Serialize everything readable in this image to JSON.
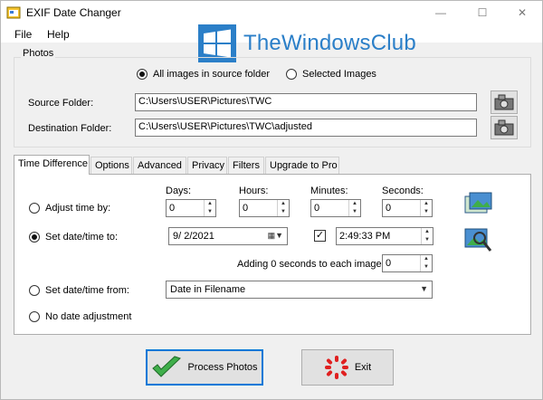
{
  "window": {
    "title": "EXIF Date Changer"
  },
  "watermark": {
    "text": "TheWindowsClub"
  },
  "menu": {
    "file": "File",
    "help": "Help"
  },
  "photos": {
    "group_label": "Photos",
    "radio_all": "All images in source folder",
    "radio_selected": "Selected Images",
    "source_label": "Source Folder:",
    "source_value": "C:\\Users\\USER\\Pictures\\TWC",
    "dest_label": "Destination Folder:",
    "dest_value": "C:\\Users\\USER\\Pictures\\TWC\\adjusted"
  },
  "tabs": [
    "Time Difference",
    "Options",
    "Advanced",
    "Privacy",
    "Filters",
    "Upgrade to Pro"
  ],
  "time": {
    "adjust_label": "Adjust time by:",
    "days_label": "Days:",
    "hours_label": "Hours:",
    "minutes_label": "Minutes:",
    "seconds_label": "Seconds:",
    "days": "0",
    "hours": "0",
    "minutes": "0",
    "seconds": "0",
    "setdate_label": "Set date/time to:",
    "date_value": "9/  2/2021",
    "checkbox_mark": "✓",
    "time_value": "2:49:33 PM",
    "adding_label": "Adding 0 seconds to each image",
    "adding_value": "0",
    "setfrom_label": "Set date/time from:",
    "setfrom_value": "Date in Filename",
    "nodate_label": "No date adjustment"
  },
  "buttons": {
    "process": "Process Photos",
    "exit": "Exit"
  },
  "colors": {
    "accent": "#0078d7",
    "watermark": "#2b7fc8"
  }
}
